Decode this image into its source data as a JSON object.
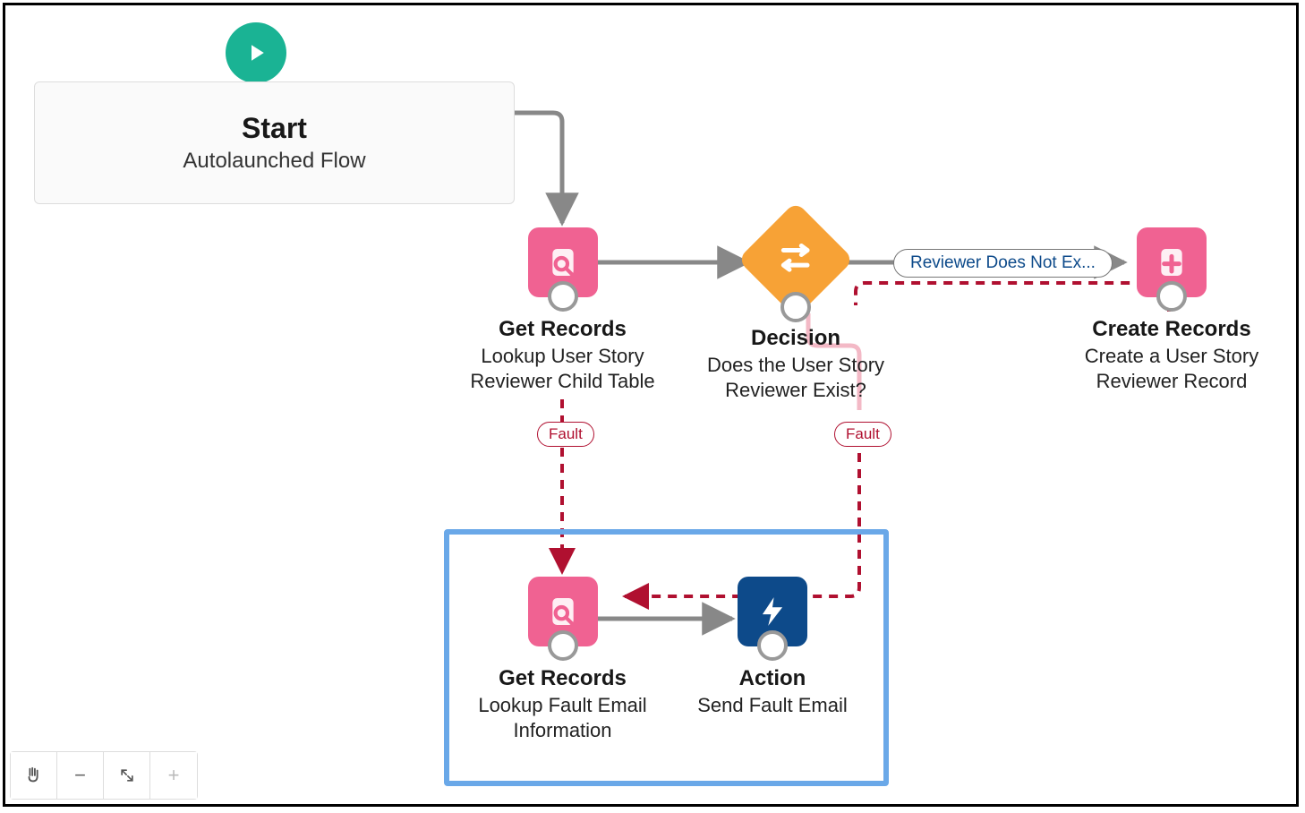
{
  "start": {
    "title": "Start",
    "subtitle": "Autolaunched Flow"
  },
  "nodes": {
    "getRecords1": {
      "title": "Get Records",
      "sub": "Lookup User Story Reviewer Child Table"
    },
    "decision": {
      "title": "Decision",
      "sub": "Does the User Story Reviewer Exist?"
    },
    "createRecs": {
      "title": "Create Records",
      "sub": "Create a User Story Reviewer Record"
    },
    "getRecords2": {
      "title": "Get Records",
      "sub": "Lookup Fault Email Information"
    },
    "action": {
      "title": "Action",
      "sub": "Send Fault Email"
    }
  },
  "labels": {
    "fault": "Fault",
    "reviewerDoesNotExist": "Reviewer Does Not Ex..."
  },
  "toolbar": {
    "minus": "−",
    "plus": "+"
  }
}
